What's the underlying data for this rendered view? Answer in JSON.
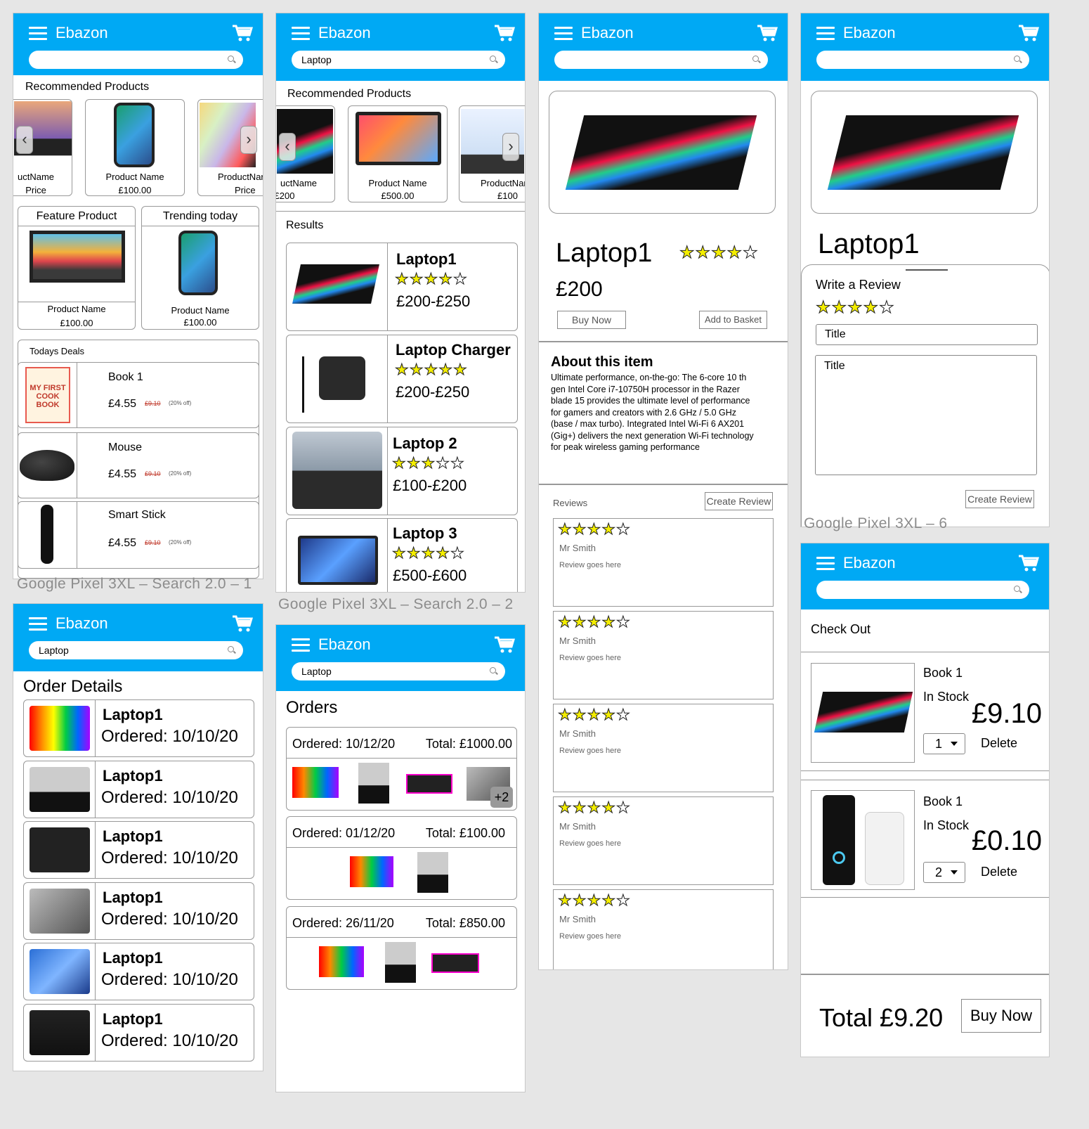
{
  "brand": "Ebazon",
  "colors": {
    "header": "#00a9f4",
    "star": "#f4ee00",
    "strike": "#c0392b"
  },
  "search": {
    "empty": "",
    "query": "Laptop"
  },
  "labels": {
    "f1": "Google Pixel 3XL – Search 2.0 – 1",
    "f2": "Google Pixel 3XL – Search 2.0 – 2",
    "f6": "Google Pixel 3XL – 6"
  },
  "home": {
    "recommended_title": "Recommended Products",
    "rec": [
      {
        "name": "uctName",
        "price": "Price"
      },
      {
        "name": "Product Name",
        "price": "£100.00"
      },
      {
        "name": "ProductNar",
        "price": "Price"
      }
    ],
    "feature_title": "Feature Product",
    "feature": {
      "name": "Product Name",
      "price": "£100.00"
    },
    "trending_title": "Trending today",
    "trending": {
      "name": "Product Name",
      "price": "£100.00"
    },
    "deals_title": "Todays Deals",
    "deals": [
      {
        "name": "Book 1",
        "price": "£4.55",
        "old": "£9.10",
        "off": "(20% off)"
      },
      {
        "name": "Mouse",
        "price": "£4.55",
        "old": "£9.10",
        "off": "(20% off)"
      },
      {
        "name": "Smart Stick",
        "price": "£4.55",
        "old": "£9.10",
        "off": "(20% off)"
      }
    ]
  },
  "results_page": {
    "recommended_title": "Recommended Products",
    "rec": [
      {
        "name": "uctName",
        "price": "£200"
      },
      {
        "name": "Product Name",
        "price": "£500.00"
      },
      {
        "name": "ProductNar",
        "price": "£100"
      }
    ],
    "results_title": "Results",
    "results": [
      {
        "name": "Laptop1",
        "rating": 4,
        "price": "£200-£250"
      },
      {
        "name": "Laptop Charger",
        "rating": 5,
        "price": "£200-£250"
      },
      {
        "name": "Laptop 2",
        "rating": 3,
        "price": "£100-£200"
      },
      {
        "name": "Laptop 3",
        "rating": 4,
        "price": "£500-£600"
      }
    ]
  },
  "product": {
    "name": "Laptop1",
    "rating": 4,
    "price": "£200",
    "buy_now": "Buy Now",
    "add_basket": "Add to Basket",
    "about_title": "About this item",
    "about_lines": [
      "Ultimate performance, on-the-go: The 6-core 10 th",
      "gen Intel Core i7-10750H processor in the Razer",
      "blade 15 provides the ultimate level of performance",
      "for gamers and creators with 2.6 GHz / 5.0 GHz",
      "(base / max turbo). Integrated Intel Wi-Fi 6 AX201",
      "(Gig+) delivers the next generation Wi-Fi technology",
      "for peak wireless gaming performance"
    ],
    "reviews_title": "Reviews",
    "create_review": "Create Review",
    "reviews": [
      {
        "rating": 4,
        "author": "Mr Smith",
        "text": "Review goes here"
      },
      {
        "rating": 4,
        "author": "Mr Smith",
        "text": "Review goes here"
      },
      {
        "rating": 4,
        "author": "Mr Smith",
        "text": "Review goes here"
      },
      {
        "rating": 4,
        "author": "Mr Smith",
        "text": "Review goes here"
      },
      {
        "rating": 4,
        "author": "Mr Smith",
        "text": "Review goes here"
      }
    ]
  },
  "review_form": {
    "name": "Laptop1",
    "title": "Write a Review",
    "rating": 4,
    "title_placeholder": "Title",
    "body_placeholder": "Title",
    "submit": "Create Review"
  },
  "checkout": {
    "title": "Check Out",
    "items": [
      {
        "name": "Book 1",
        "stock": "In Stock",
        "price": "£9.10",
        "qty": "1",
        "delete": "Delete"
      },
      {
        "name": "Book 1",
        "stock": "In Stock",
        "price": "£0.10",
        "qty": "2",
        "delete": "Delete"
      }
    ],
    "total": "Total £9.20",
    "buy_now": "Buy Now"
  },
  "order_details": {
    "title": "Order Details",
    "items": [
      {
        "name": "Laptop1",
        "ordered": "Ordered: 10/10/20"
      },
      {
        "name": "Laptop1",
        "ordered": "Ordered: 10/10/20"
      },
      {
        "name": "Laptop1",
        "ordered": "Ordered: 10/10/20"
      },
      {
        "name": "Laptop1",
        "ordered": "Ordered: 10/10/20"
      },
      {
        "name": "Laptop1",
        "ordered": "Ordered: 10/10/20"
      },
      {
        "name": "Laptop1",
        "ordered": "Ordered: 10/10/20"
      }
    ]
  },
  "orders": {
    "title": "Orders",
    "list": [
      {
        "date": "Ordered: 10/12/20",
        "total": "Total: £1000.00",
        "more": "+2"
      },
      {
        "date": "Ordered: 01/12/20",
        "total": "Total: £100.00"
      },
      {
        "date": "Ordered: 26/11/20",
        "total": "Total: £850.00"
      }
    ]
  }
}
